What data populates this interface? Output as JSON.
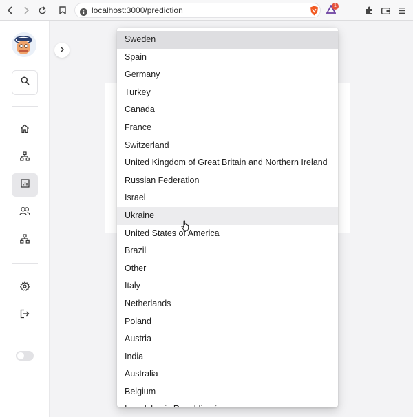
{
  "browser": {
    "url": "localhost:3000/prediction",
    "notification_count": "1"
  },
  "sidebar": {
    "items": [
      {
        "name": "home"
      },
      {
        "name": "network"
      },
      {
        "name": "prediction",
        "active": true
      },
      {
        "name": "users"
      },
      {
        "name": "network-2"
      },
      {
        "name": "settings"
      },
      {
        "name": "logout"
      }
    ]
  },
  "dropdown": {
    "selected": "Sweden",
    "hovered": "Ukraine",
    "options": [
      "Sweden",
      "Spain",
      "Germany",
      "Turkey",
      "Canada",
      "France",
      "Switzerland",
      "United Kingdom of Great Britain and Northern Ireland",
      "Russian Federation",
      "Israel",
      "Ukraine",
      "United States of America",
      "Brazil",
      "Other",
      "Italy",
      "Netherlands",
      "Poland",
      "Austria",
      "India",
      "Australia",
      "Belgium",
      "Iran, Islamic Republic of..."
    ]
  },
  "colors": {
    "selected_bg": "#dedee1",
    "hover_bg": "#ececee",
    "sidebar_active_bg": "#e7e7ea",
    "brave_orange": "#f25a23"
  }
}
